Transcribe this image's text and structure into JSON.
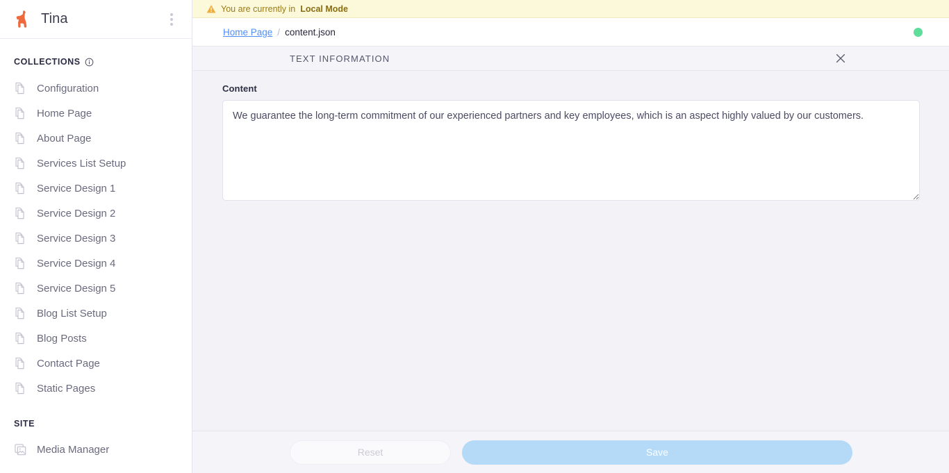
{
  "app": {
    "brand_name": "Tina",
    "logo_icon": "llama-icon",
    "menu_icon": "kebab-menu-icon"
  },
  "sidebar": {
    "sections": [
      {
        "title": "COLLECTIONS",
        "has_info_icon": true,
        "info_icon": "info-circle-icon",
        "items": [
          {
            "label": "Configuration",
            "icon": "documents-icon"
          },
          {
            "label": "Home Page",
            "icon": "documents-icon"
          },
          {
            "label": "About Page",
            "icon": "documents-icon"
          },
          {
            "label": "Services List Setup",
            "icon": "documents-icon"
          },
          {
            "label": "Service Design 1",
            "icon": "documents-icon"
          },
          {
            "label": "Service Design 2",
            "icon": "documents-icon"
          },
          {
            "label": "Service Design 3",
            "icon": "documents-icon"
          },
          {
            "label": "Service Design 4",
            "icon": "documents-icon"
          },
          {
            "label": "Service Design 5",
            "icon": "documents-icon"
          },
          {
            "label": "Blog List Setup",
            "icon": "documents-icon"
          },
          {
            "label": "Blog Posts",
            "icon": "documents-icon"
          },
          {
            "label": "Contact Page",
            "icon": "documents-icon"
          },
          {
            "label": "Static Pages",
            "icon": "documents-icon"
          }
        ]
      },
      {
        "title": "SITE",
        "has_info_icon": false,
        "items": [
          {
            "label": "Media Manager",
            "icon": "media-images-icon"
          }
        ]
      }
    ]
  },
  "banner": {
    "icon": "warning-triangle-icon",
    "text_prefix": "You are currently in ",
    "mode": "Local Mode"
  },
  "breadcrumb": {
    "parent": "Home Page",
    "separator": "/",
    "current": "content.json",
    "status_dot_color": "#5fdd9a"
  },
  "form": {
    "header_title": "TEXT INFORMATION",
    "close_icon": "close-icon",
    "fields": [
      {
        "label": "Content",
        "value": "We guarantee the long-term commitment of our experienced partners and key employees, which is an aspect highly valued by our customers.",
        "placeholder": ""
      }
    ],
    "footer": {
      "reset_label": "Reset",
      "save_label": "Save"
    }
  },
  "colors": {
    "brand_orange": "#ee6a3c",
    "banner_bg": "#fcf8da",
    "banner_text": "#9a7b18",
    "link_blue": "#4f8ef7",
    "save_blue": "#b4daf8",
    "status_green": "#5fdd9a"
  }
}
